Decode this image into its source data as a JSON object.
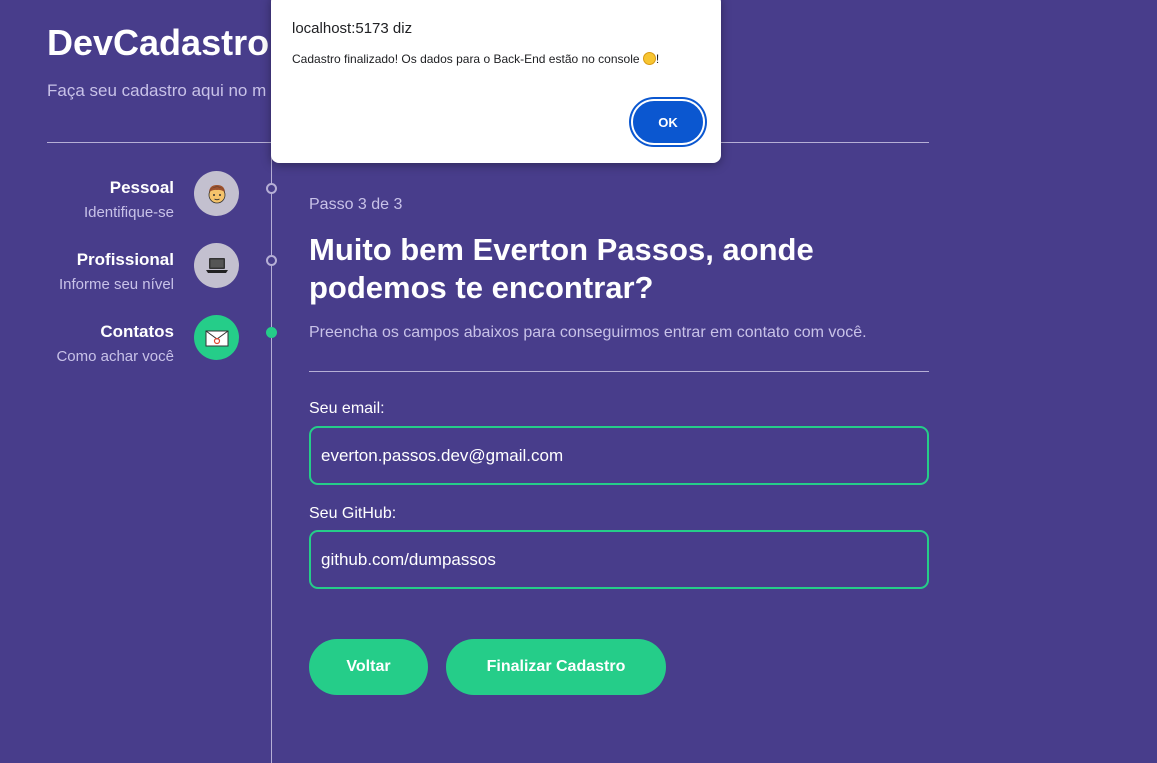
{
  "app": {
    "title": "DevCadastro",
    "subtitle": "Faça seu cadastro aqui no m"
  },
  "steps": [
    {
      "title": "Pessoal",
      "desc": "Identifique-se",
      "icon": "person-icon",
      "active": false
    },
    {
      "title": "Profissional",
      "desc": "Informe seu nível",
      "icon": "laptop-icon",
      "active": false
    },
    {
      "title": "Contatos",
      "desc": "Como achar você",
      "icon": "envelope-icon",
      "active": true
    }
  ],
  "main": {
    "step_counter": "Passo 3 de 3",
    "heading": "Muito bem Everton Passos, aonde podemos te encontrar?",
    "description": "Preencha os campos abaixos para conseguirmos entrar em contato com você.",
    "email_label": "Seu email:",
    "email_value": "everton.passos.dev@gmail.com",
    "github_label": "Seu GitHub:",
    "github_value": "github.com/dumpassos",
    "back_label": "Voltar",
    "finish_label": "Finalizar Cadastro"
  },
  "dialog": {
    "origin": "localhost:5173 diz",
    "message": "Cadastro finalizado! Os dados para o Back-End estão no console ",
    "message_end": "!",
    "ok_label": "OK"
  },
  "colors": {
    "background": "#483d8b",
    "accent": "#25cd89",
    "dialog_button": "#0b57d0"
  }
}
